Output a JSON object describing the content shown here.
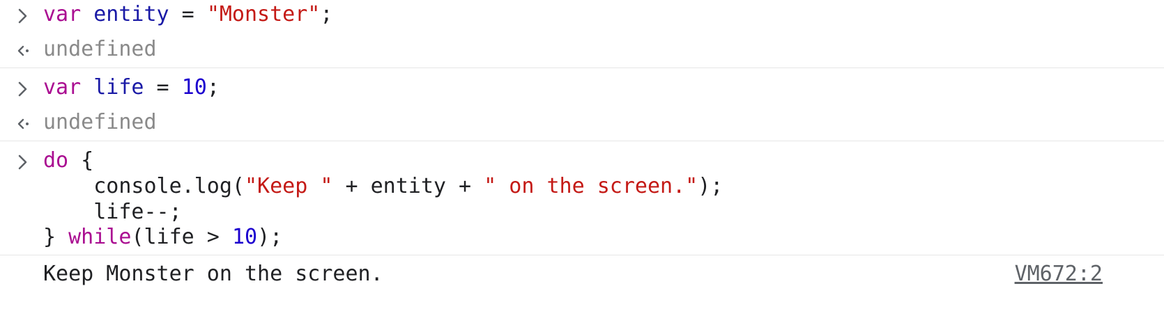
{
  "entries": [
    {
      "input": {
        "kw": "var",
        "name": "entity",
        "op": " = ",
        "str": "\"Monster\"",
        "end": ";"
      },
      "result": "undefined"
    },
    {
      "input": {
        "kw": "var",
        "name": "life",
        "op": " = ",
        "num": "10",
        "end": ";"
      },
      "result": "undefined"
    }
  ],
  "loop": {
    "line1_kw": "do",
    "line1_rest": " {",
    "line2_a": "    console.log(",
    "line2_str1": "\"Keep \"",
    "line2_b": " + entity + ",
    "line2_str2": "\" on the screen.\"",
    "line2_c": ");",
    "line3": "    life--;",
    "line4_a": "} ",
    "line4_kw": "while",
    "line4_b": "(life > ",
    "line4_num": "10",
    "line4_c": ");"
  },
  "log_output": {
    "text": "Keep Monster on the screen.",
    "source": "VM672:2"
  },
  "icons": {
    "input_prompt": "chevron-right-icon",
    "result_prompt": "return-arrow-icon"
  },
  "colors": {
    "keyword": "#aa0d91",
    "variable": "#1a1aa6",
    "string": "#c41a16",
    "number": "#1c00cf",
    "result": "#8a8a8a"
  }
}
